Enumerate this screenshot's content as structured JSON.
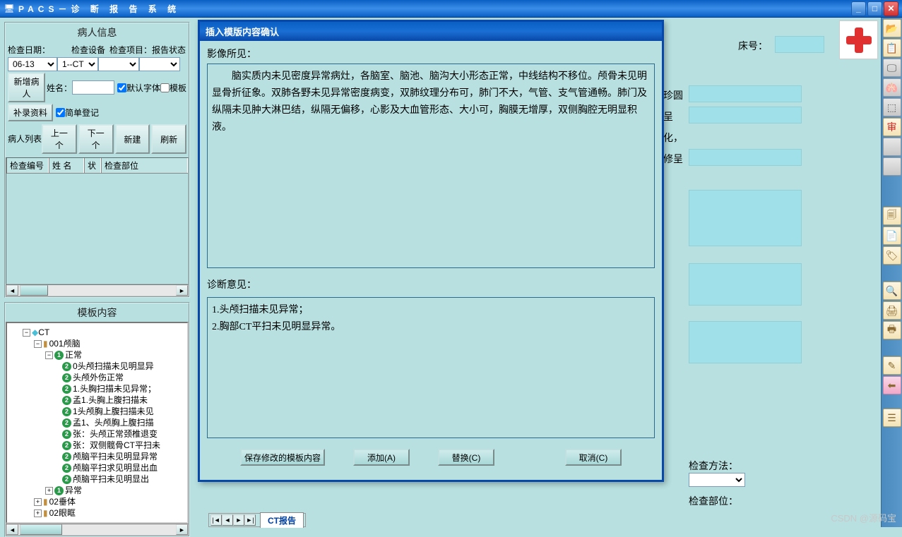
{
  "window": {
    "title": "PACS－诊 断 报 告 系 统"
  },
  "leftPanel": {
    "patientInfoTitle": "病人信息",
    "labels": {
      "checkDate": "检查日期：",
      "checkDevice": "检查设备",
      "checkItem": "检查项目：",
      "reportStatus": "报告状态",
      "newPatient": "新增病人",
      "name": "姓名：",
      "defaultFont": "默认字体",
      "template": "模板",
      "supplement": "补录资料",
      "simpleReg": "简单登记",
      "patientList": "病人列表"
    },
    "values": {
      "date": "06-13",
      "device": "1--CT"
    },
    "navButtons": {
      "prev": "上一个",
      "next": "下一个",
      "new": "新建",
      "refresh": "刷新"
    },
    "tableHeaders": [
      "检查编号",
      "姓 名",
      "状",
      "检查部位"
    ],
    "templateTitle": "模板内容",
    "tree": {
      "root": "CT",
      "l1": "001颅脑",
      "l2": "正常",
      "items": [
        "0头颅扫描未见明显异",
        "头颅外伤正常",
        "1.头胸扫描未见异常；",
        "孟1.头胸上腹扫描未",
        "1头颅胸上腹扫描未见",
        "孟1、头颅胸上腹扫描",
        "张：头颅正常颈椎退变",
        "张：双侧髋骨CT平扫未",
        "颅脑平扫未见明显异常",
        "颅脑平扫求见明显出血",
        "颅脑平扫未见明显出"
      ],
      "l3a": "异常",
      "l3b": "02垂体",
      "l3c": "02眼眶"
    }
  },
  "modal": {
    "title": "插入模版内容确认",
    "findingsLabel": "影像所见：",
    "findingsText": "　　脑实质内未见密度异常病灶，各脑室、脑池、脑沟大小形态正常，中线结构不移位。颅骨未见明显骨折征象。双肺各野未见异常密度病变，双肺纹理分布可，肺门不大，气管、支气管通畅。肺门及纵隔未见肿大淋巴结，纵隔无偏移，心影及大血管形态、大小可，胸膜无增厚，双侧胸腔无明显积液。",
    "diagnosisLabel": "诊断意见：",
    "diagnosisText": "1.头颅扫描未见异常；\n2.胸部CT平扫未见明显异常。",
    "buttons": {
      "save": "保存修改的模板内容",
      "add": "添加(A)",
      "replace": "替换(C)",
      "cancel": "取消(C)"
    }
  },
  "background": {
    "deptNo": "床号：",
    "frag1": "珍圆",
    "frag2": "呈",
    "frag3": "化，",
    "frag4": "修呈",
    "checkMethod": "检查方法：",
    "checkPart": "检查部位："
  },
  "tabstrip": {
    "active": "CT报告"
  },
  "watermark": "CSDN @源码宝"
}
